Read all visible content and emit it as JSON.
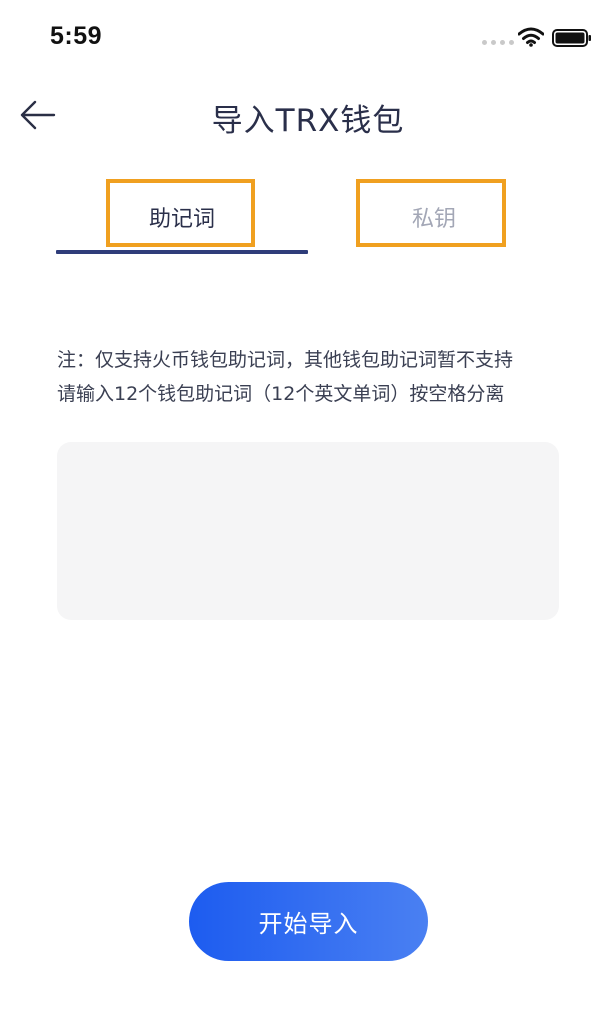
{
  "status_bar": {
    "time": "5:59"
  },
  "header": {
    "title": "导入TRX钱包",
    "back_icon": "arrow-left-icon"
  },
  "tabs": [
    {
      "label": "助记词",
      "active": true
    },
    {
      "label": "私钥",
      "active": false
    }
  ],
  "notes": {
    "line1": "注：仅支持火币钱包助记词，其他钱包助记词暂不支持",
    "line2": "请输入12个钱包助记词（12个英文单词）按空格分离"
  },
  "mnemonic_input": {
    "value": "",
    "placeholder": ""
  },
  "import_button": {
    "label": "开始导入"
  },
  "colors": {
    "accent": "#1d5cf0",
    "accent_end": "#4a80f2",
    "tab_underline": "#2f3d7a",
    "highlight_box": "#f0a020",
    "inactive_tab": "#a3a7b6",
    "input_bg": "#f5f5f6"
  }
}
